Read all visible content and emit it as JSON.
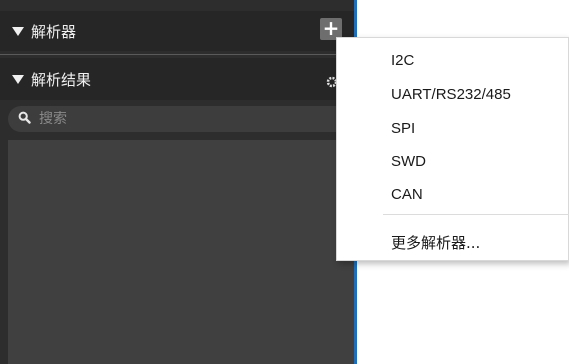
{
  "panel": {
    "sections": [
      {
        "title": "解析器"
      },
      {
        "title": "解析结果"
      }
    ],
    "add_label": "+",
    "search": {
      "placeholder": "搜索"
    }
  },
  "menu": {
    "items": [
      "I2C",
      "UART/RS232/485",
      "SPI",
      "SWD",
      "CAN"
    ],
    "more": "更多解析器..."
  },
  "colors": {
    "panel_bg": "#2d2d2d",
    "accent_edge": "#1e6fb8",
    "menu_bg": "#ffffff"
  }
}
